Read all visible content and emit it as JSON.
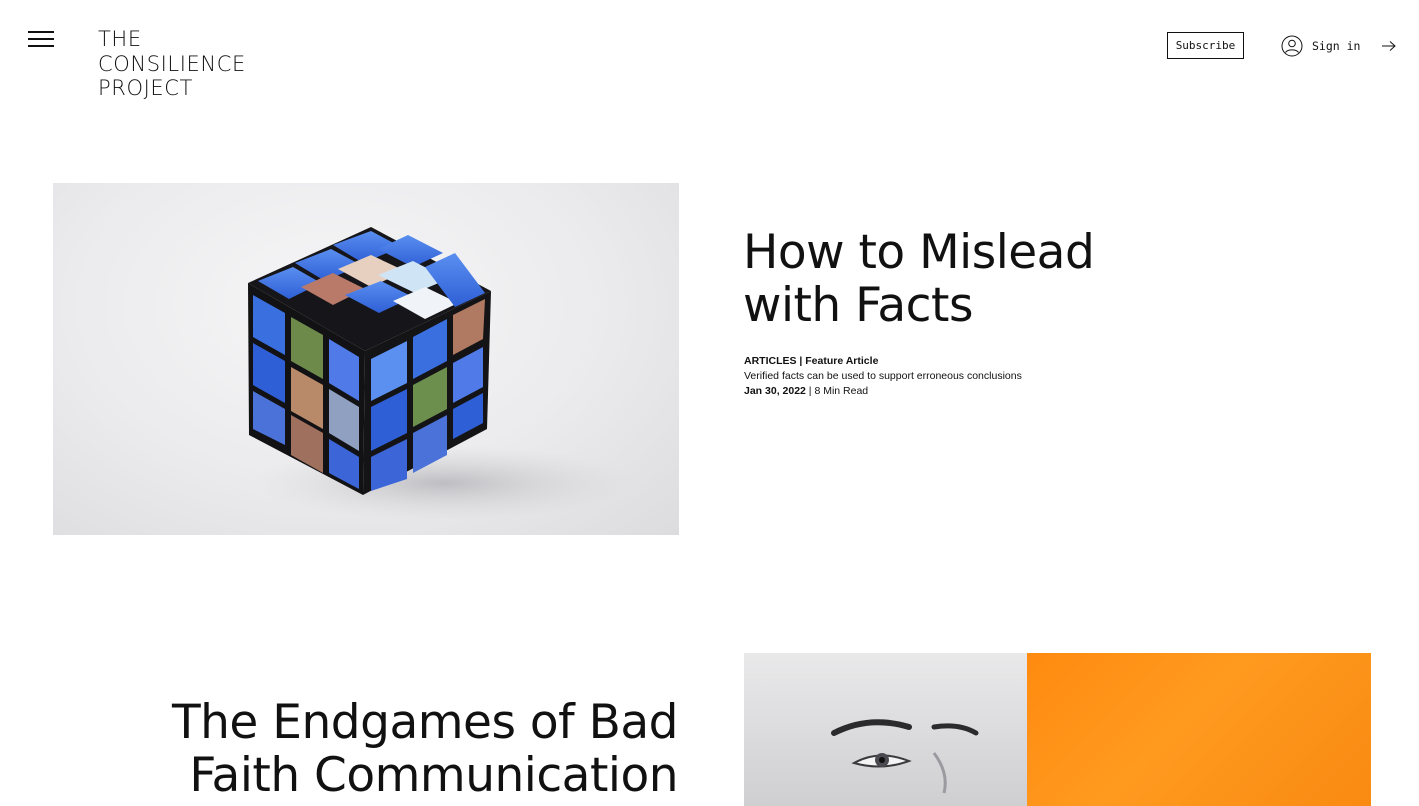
{
  "header": {
    "logo_lines": [
      "THE",
      "CONSILIENCE",
      "PROJECT"
    ],
    "subscribe_label": "Subscribe",
    "signin_label": "Sign in"
  },
  "articles": [
    {
      "title_lines": [
        "How to Mislead",
        "with Facts"
      ],
      "category": "ARTICLES | Feature Article",
      "subtitle": "Verified facts can be used to support erroneous conclusions",
      "date": "Jan 30, 2022",
      "separator": " | ",
      "read_time": "8 Min Read"
    },
    {
      "title_lines": [
        "The Endgames of Bad",
        "Faith Communication"
      ]
    }
  ],
  "colors": {
    "text": "#111111",
    "accent_orange": "#ff8b10",
    "background": "#ffffff"
  },
  "icons": [
    "hamburger-menu-icon",
    "user-icon",
    "arrow-right-icon"
  ]
}
